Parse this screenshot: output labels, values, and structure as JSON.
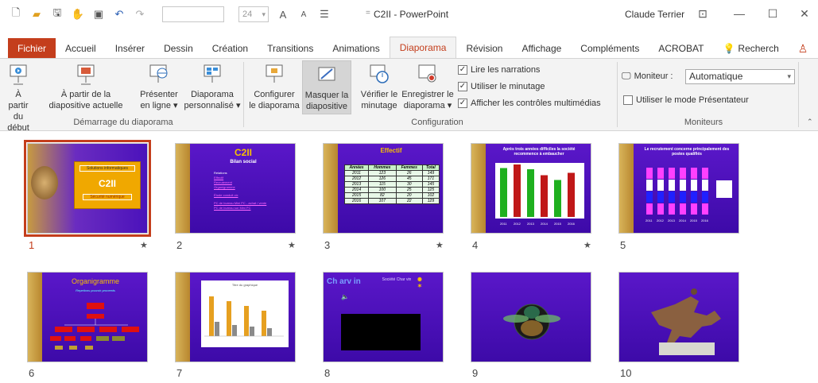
{
  "title": {
    "doc": "C2II - PowerPoint",
    "sep": "=",
    "user": "Claude Terrier",
    "font_size": "24"
  },
  "tabs": [
    {
      "label": "Fichier"
    },
    {
      "label": "Accueil"
    },
    {
      "label": "Insérer"
    },
    {
      "label": "Dessin"
    },
    {
      "label": "Création"
    },
    {
      "label": "Transitions"
    },
    {
      "label": "Animations"
    },
    {
      "label": "Diaporama"
    },
    {
      "label": "Révision"
    },
    {
      "label": "Affichage"
    },
    {
      "label": "Compléments"
    },
    {
      "label": "ACROBAT"
    },
    {
      "label": "Recherch"
    }
  ],
  "ribbon": {
    "btn_from_start": [
      "À partir",
      "du début"
    ],
    "btn_from_current": [
      "À partir de la",
      "diapositive actuelle"
    ],
    "btn_present_online": [
      "Présenter",
      "en ligne ▾"
    ],
    "btn_custom_show": [
      "Diaporama",
      "personnalisé ▾"
    ],
    "group_start": "Démarrage du diaporama",
    "btn_setup": [
      "Configurer",
      "le diaporama"
    ],
    "btn_hide": [
      "Masquer la",
      "diapositive"
    ],
    "btn_rehearse": [
      "Vérifier le",
      "minutage"
    ],
    "btn_record": [
      "Enregistrer le",
      "diaporama ▾"
    ],
    "chk_narrations": "Lire les narrations",
    "chk_timings": "Utiliser le minutage",
    "chk_media": "Afficher les contrôles multimédias",
    "group_setup": "Configuration",
    "monitor_label": "Moniteur :",
    "monitor_value": "Automatique",
    "chk_presenter": "Utiliser le mode Présentateur",
    "group_monitors": "Moniteurs"
  },
  "slides": [
    {
      "num": "1",
      "star": "★",
      "title": "C2II",
      "l1": "Solutions informatiques",
      "l2": "Sécurité numérique"
    },
    {
      "num": "2",
      "star": "★",
      "title": "C2II",
      "sub": "Bilan social",
      "l1": "Relations",
      "l2": "Effectif",
      "l3": "Recrutement",
      "l4": "Organigramme",
      "l5": "Étude conduit cix",
      "l6": "PC de bureau Mini PC - achat / vente PC de bureau sur Mini PC"
    },
    {
      "num": "3",
      "star": "★",
      "title": "Effectif"
    },
    {
      "num": "4",
      "star": "★",
      "title": "Après trois années difficiles la société recommence à embaucher"
    },
    {
      "num": "5",
      "star": "",
      "title": "Le recrutement concerne principalement des postes qualifiés"
    },
    {
      "num": "6",
      "star": "",
      "title": "Organigramme",
      "sub": "Repetions pouvoir proceeds"
    },
    {
      "num": "7",
      "star": "",
      "title": "Titre du graphique"
    },
    {
      "num": "8",
      "star": "",
      "title": "Ch arv in",
      "sub": "Société Char vin"
    },
    {
      "num": "9",
      "star": "",
      "title": ""
    },
    {
      "num": "10",
      "star": "",
      "title": ""
    }
  ],
  "table3": {
    "headers": [
      "Années",
      "Hommes",
      "Femmes",
      "Total"
    ],
    "rows": [
      [
        "2011",
        "123",
        "26",
        "149"
      ],
      [
        "2012",
        "126",
        "45",
        "171"
      ],
      [
        "2013",
        "115",
        "30",
        "145"
      ],
      [
        "2014",
        "100",
        "25",
        "125"
      ],
      [
        "2015",
        "82",
        "20",
        "102"
      ],
      [
        "2016",
        "107",
        "22",
        "129"
      ]
    ]
  },
  "chart4_years": [
    "2011",
    "2012",
    "2013",
    "2014",
    "2015",
    "2016"
  ],
  "chart4_values": [
    82,
    88,
    80,
    70,
    62,
    74
  ],
  "chart5_years": [
    "2011",
    "2012",
    "2013",
    "2014",
    "2015",
    "2016"
  ],
  "colors": {
    "accent": "#c43e1c",
    "slide_bg": "#4b12bb",
    "strip": "#c89a3e"
  }
}
